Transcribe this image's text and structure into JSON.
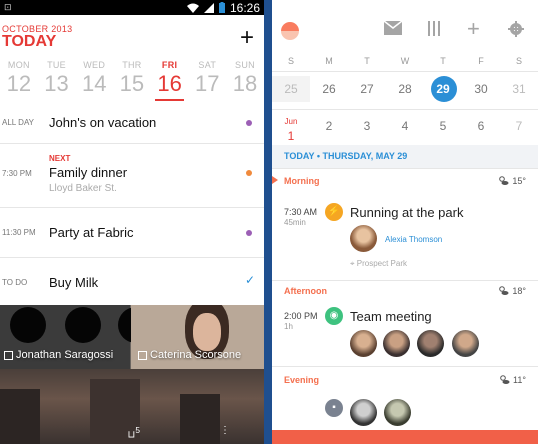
{
  "left": {
    "status_time": "16:26",
    "month_label": "OCTOBER 2013",
    "today_label": "TODAY",
    "add_symbol": "+",
    "week": [
      {
        "name": "MON",
        "num": "12"
      },
      {
        "name": "TUE",
        "num": "13"
      },
      {
        "name": "WED",
        "num": "14"
      },
      {
        "name": "THR",
        "num": "15"
      },
      {
        "name": "FRI",
        "num": "16"
      },
      {
        "name": "SAT",
        "num": "17"
      },
      {
        "name": "SUN",
        "num": "18"
      }
    ],
    "events": [
      {
        "time": "ALL DAY",
        "title": "John's on vacation",
        "color": "#9c5fb5"
      },
      {
        "time": "7:30 PM",
        "next": "NEXT",
        "title": "Family dinner",
        "subtitle": "Lloyd Baker St.",
        "color": "#f08a3c"
      },
      {
        "time": "11:30 PM",
        "title": "Party at Fabric",
        "color": "#9c5fb5"
      },
      {
        "time": "TO DO",
        "title": "Buy Milk",
        "check": "✓"
      }
    ],
    "contacts": [
      {
        "name": "Jonathan Saragossi"
      },
      {
        "name": "Caterina Scorsone"
      }
    ],
    "badge_count": "5",
    "menu_glyph": "⋮"
  },
  "right": {
    "day_names": [
      "S",
      "M",
      "T",
      "W",
      "T",
      "F",
      "S"
    ],
    "row1": [
      "25",
      "26",
      "27",
      "28",
      "29",
      "30",
      "31"
    ],
    "row2_month": "Jun",
    "row2": [
      "1",
      "2",
      "3",
      "4",
      "5",
      "6",
      "7"
    ],
    "agenda_today": "TODAY",
    "agenda_sep": "•",
    "agenda_date": "THURSDAY, MAY 29",
    "sections": [
      {
        "label": "Morning",
        "temp": "15°"
      },
      {
        "label": "Afternoon",
        "temp": "18°"
      },
      {
        "label": "Evening",
        "temp": "11°"
      }
    ],
    "event1": {
      "time": "7:30 AM",
      "duration": "45min",
      "title": "Running at the park",
      "person": "Alexia Thomson",
      "location": "Prospect Park"
    },
    "event2": {
      "time": "2:00 PM",
      "duration": "1h",
      "title": "Team meeting"
    },
    "colors": {
      "accent": "#f4704f",
      "selected": "#2b8fd6",
      "event1_icon": "#f5a623",
      "event2_icon": "#3ec27f"
    }
  }
}
